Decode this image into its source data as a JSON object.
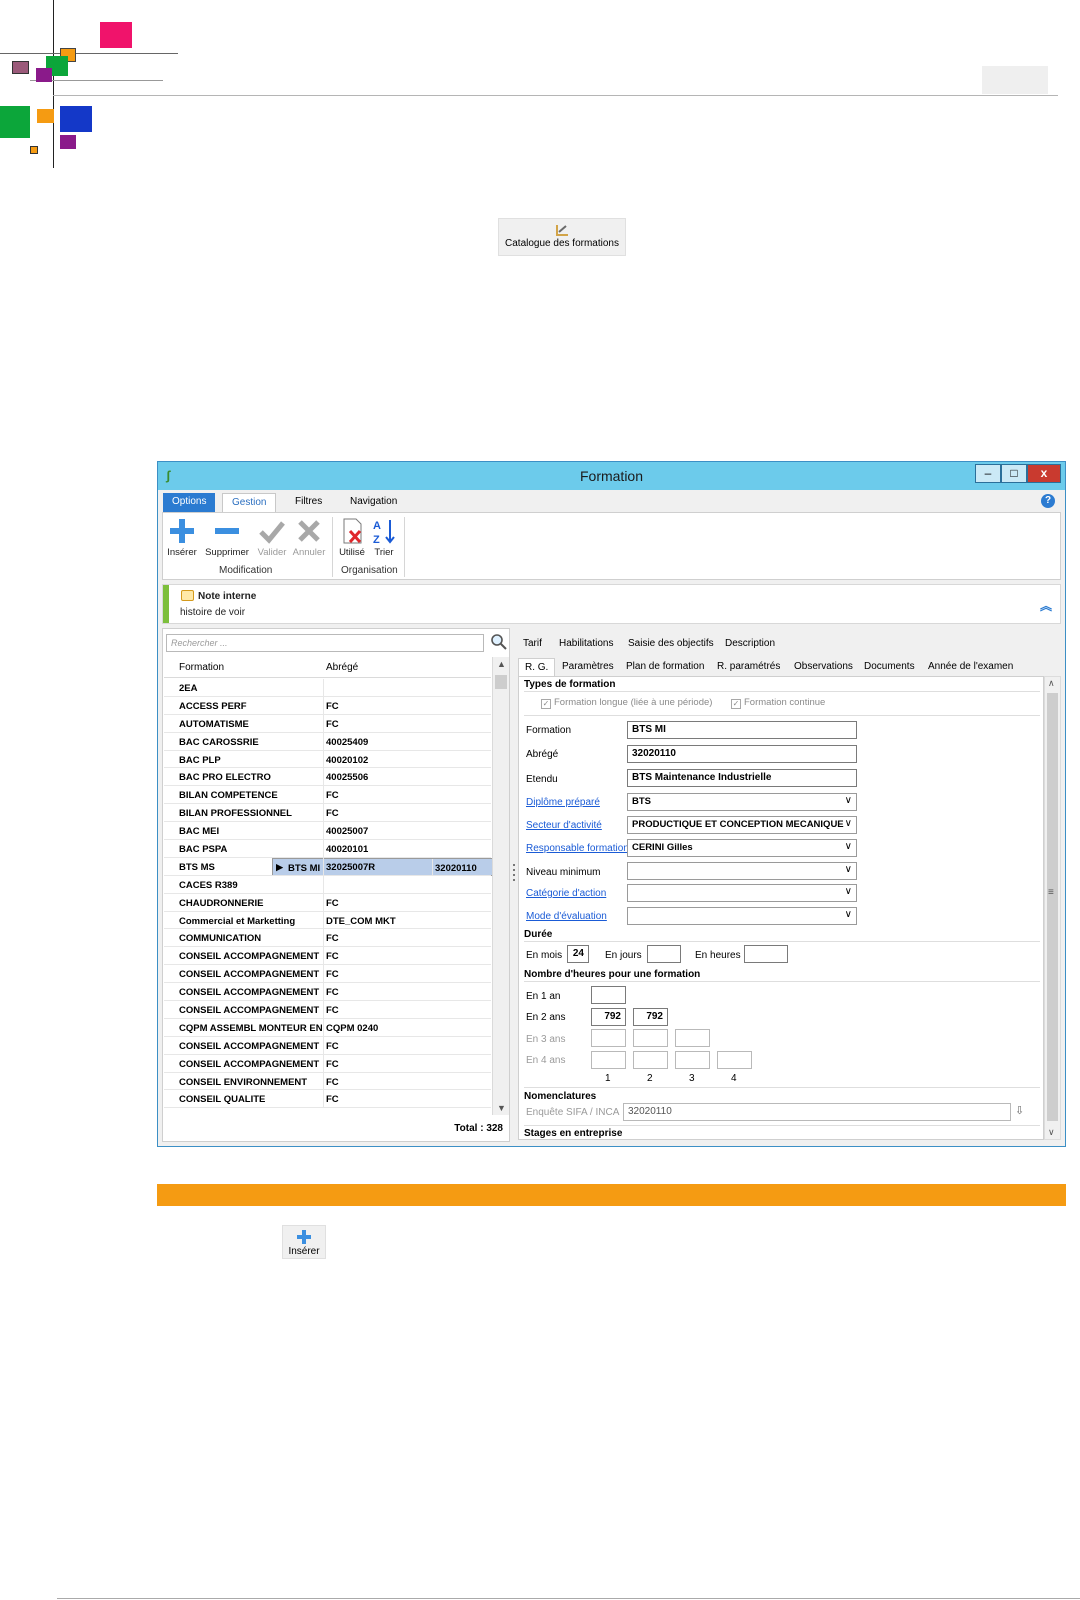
{
  "page": {
    "catalogue_button": "Catalogue des formations",
    "insert_button": "Insérer"
  },
  "window": {
    "title": "Formation",
    "controls": {
      "minimize": "–",
      "maximize": "□",
      "close": "x"
    }
  },
  "ribbon": {
    "tabs": [
      "Options",
      "Gestion",
      "Filtres",
      "Navigation"
    ],
    "active_tab": "Gestion",
    "help": "?",
    "buttons": {
      "inserer": "Insérer",
      "supprimer": "Supprimer",
      "valider": "Valider",
      "annuler": "Annuler",
      "utilise": "Utilisé",
      "trier": "Trier"
    },
    "groups": {
      "modification": "Modification",
      "organisation": "Organisation"
    }
  },
  "note": {
    "title": "Note interne",
    "text": "histoire de voir"
  },
  "list": {
    "search_placeholder": "Rechercher ...",
    "col_formation": "Formation",
    "col_abrege": "Abrégé",
    "selected_row": "BTS MI",
    "total": "Total : 328",
    "rows": [
      [
        "2EA",
        ""
      ],
      [
        "ACCESS PERF",
        "FC"
      ],
      [
        "AUTOMATISME",
        "FC"
      ],
      [
        "BAC CAROSSRIE",
        "40025409"
      ],
      [
        "BAC PLP",
        "40020102"
      ],
      [
        "BAC PRO ELECTRO",
        "40025506"
      ],
      [
        "BILAN COMPETENCE",
        "FC"
      ],
      [
        "BILAN PROFESSIONNEL",
        "FC"
      ],
      [
        "BAC MEI",
        "40025007"
      ],
      [
        "BAC PSPA",
        "40020101"
      ],
      [
        "BTS MI",
        "32020110"
      ],
      [
        "BTS MS",
        "32025007R"
      ],
      [
        "CACES R389",
        ""
      ],
      [
        "CHAUDRONNERIE",
        "FC"
      ],
      [
        "Commercial et Marketting",
        "DTE_COM MKT"
      ],
      [
        "COMMUNICATION",
        "FC"
      ],
      [
        "CONSEIL ACCOMPAGNEMENT",
        "FC"
      ],
      [
        "CONSEIL ACCOMPAGNEMENT",
        "FC"
      ],
      [
        "CONSEIL ACCOMPAGNEMENT",
        "FC"
      ],
      [
        "CONSEIL ACCOMPAGNEMENT",
        "FC"
      ],
      [
        "CQPM ASSEMBL MONTEUR EN",
        "CQPM 0240"
      ],
      [
        "CONSEIL ACCOMPAGNEMENT",
        "FC"
      ],
      [
        "CONSEIL ACCOMPAGNEMENT",
        "FC"
      ],
      [
        "CONSEIL ENVIRONNEMENT",
        "FC"
      ],
      [
        "CONSEIL QUALITE",
        "FC"
      ]
    ]
  },
  "detail": {
    "tabs_row1": [
      "Tarif",
      "Habilitations",
      "Saisie des objectifs",
      "Description"
    ],
    "tabs_row2": [
      "R. G.",
      "Paramètres",
      "Plan de formation",
      "R. paramétrés",
      "Observations",
      "Documents",
      "Année de l'examen"
    ],
    "types_title": "Types de formation",
    "chk_longue": "Formation longue (liée à une période)",
    "chk_continue": "Formation continue",
    "lbl_formation": "Formation",
    "val_formation": "BTS MI",
    "lbl_abrege": "Abrégé",
    "val_abrege": "32020110",
    "lbl_etendu": "Etendu",
    "val_etendu": "BTS Maintenance Industrielle",
    "lbl_diplome": "Diplôme préparé",
    "val_diplome": "BTS",
    "lbl_secteur": "Secteur d'activité",
    "val_secteur": "PRODUCTIQUE  ET CONCEPTION MECANIQUE",
    "lbl_responsable": "Responsable formation",
    "val_responsable": "CERINI Gilles",
    "lbl_niveau": "Niveau minimum",
    "val_niveau": "",
    "lbl_categorie": "Catégorie d'action",
    "val_categorie": "",
    "lbl_mode": "Mode d'évaluation",
    "val_mode": "",
    "duree_title": "Durée",
    "lbl_mois": "En mois",
    "val_mois": "24",
    "lbl_jours": "En jours",
    "val_jours": "",
    "lbl_heures": "En heures",
    "val_heures": "",
    "heures_title": "Nombre d'heures pour une formation",
    "lbl_1an": "En 1 an",
    "lbl_2ans": "En 2 ans",
    "lbl_3ans": "En 3 ans",
    "lbl_4ans": "En 4 ans",
    "val_2ans_1": "792",
    "val_2ans_2": "792",
    "cols": [
      "1",
      "2",
      "3",
      "4"
    ],
    "nomenclatures_title": "Nomenclatures",
    "lbl_enquete": "Enquête SIFA / INCA",
    "val_enquete": "32020110",
    "stages_title": "Stages en entreprise"
  },
  "colors": {
    "titlebar": "#6ccbeb",
    "accent_blue": "#2b7bd1",
    "selection": "#b9cde9",
    "orange_band": "#f59b12",
    "note_bar": "#7cbf3b"
  }
}
